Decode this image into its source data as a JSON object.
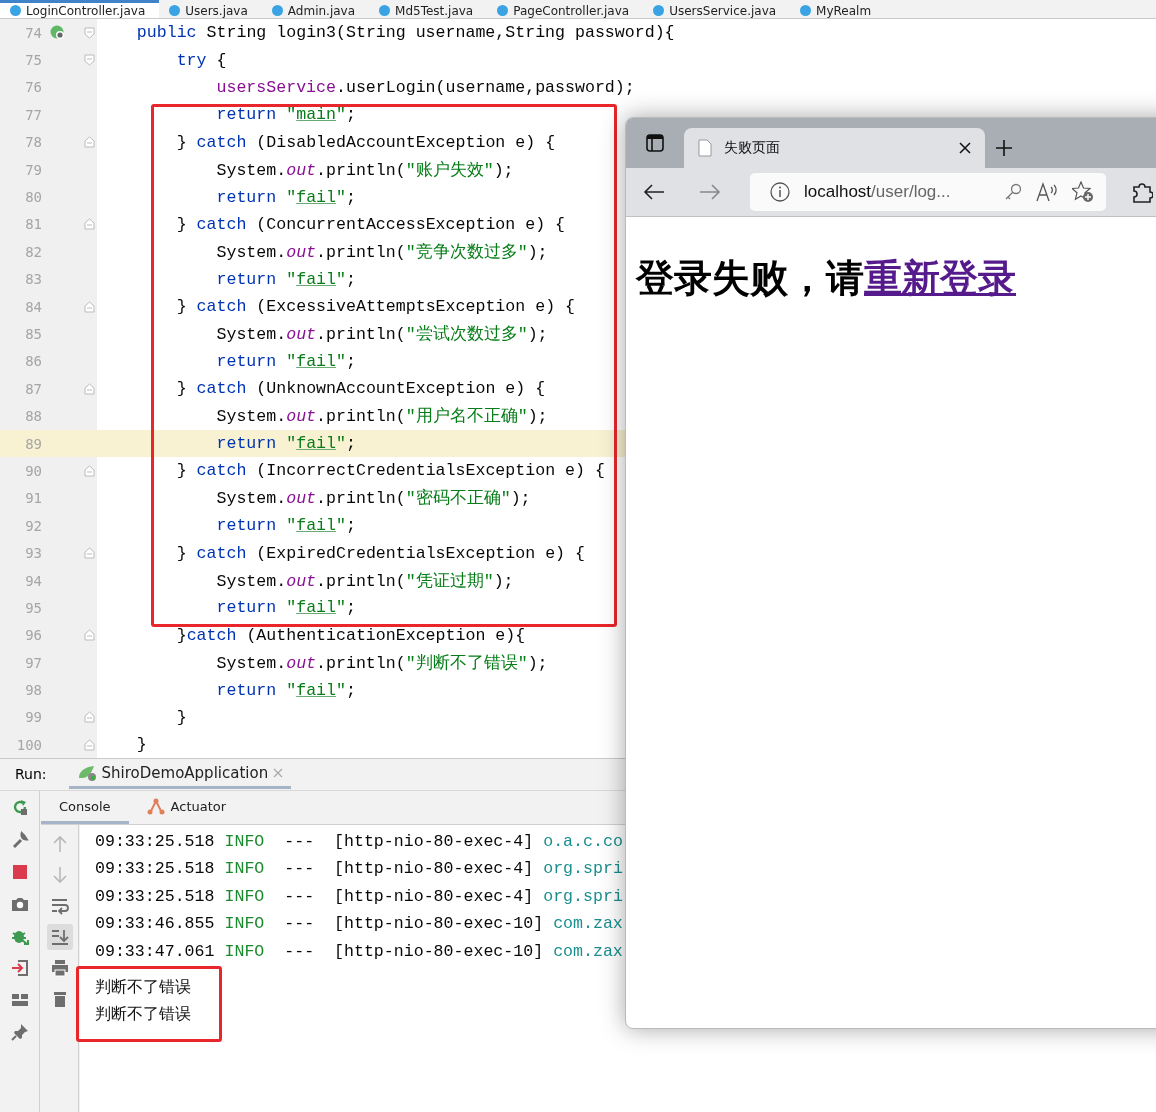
{
  "editor_tabs": [
    {
      "label": "LoginController.java",
      "selected": true
    },
    {
      "label": "Users.java",
      "selected": false
    },
    {
      "label": "Admin.java",
      "selected": false
    },
    {
      "label": "Md5Test.java",
      "selected": false
    },
    {
      "label": "PageController.java",
      "selected": false
    },
    {
      "label": "UsersService.java",
      "selected": false
    },
    {
      "label": "MyRealm",
      "selected": false
    }
  ],
  "code_lines": [
    {
      "number": "74",
      "fold_start": true,
      "fold_end": false,
      "run_marker": true,
      "current": false,
      "tokens": [
        {
          "kind": "keyword",
          "text": "    public"
        },
        {
          "kind": "plain",
          "text": " String login3(String username,String password){"
        }
      ]
    },
    {
      "number": "75",
      "fold_start": true,
      "fold_end": false,
      "run_marker": false,
      "current": false,
      "tokens": [
        {
          "kind": "keyword",
          "text": "        try"
        },
        {
          "kind": "plain",
          "text": " {"
        }
      ]
    },
    {
      "number": "76",
      "fold_start": false,
      "fold_end": false,
      "run_marker": false,
      "current": false,
      "tokens": [
        {
          "kind": "field",
          "text": "            usersService"
        },
        {
          "kind": "plain",
          "text": ".userLogin(username,password);"
        }
      ]
    },
    {
      "number": "77",
      "fold_start": false,
      "fold_end": false,
      "run_marker": false,
      "current": false,
      "tokens": [
        {
          "kind": "keyword",
          "text": "            return"
        },
        {
          "kind": "string",
          "text": " \""
        },
        {
          "kind": "typo",
          "text": "main"
        },
        {
          "kind": "string",
          "text": "\""
        },
        {
          "kind": "plain",
          "text": ";"
        }
      ]
    },
    {
      "number": "78",
      "fold_start": false,
      "fold_end": true,
      "run_marker": false,
      "current": false,
      "tokens": [
        {
          "kind": "plain",
          "text": "        } "
        },
        {
          "kind": "keyword",
          "text": "catch"
        },
        {
          "kind": "plain",
          "text": " (DisabledAccountException e) {"
        }
      ]
    },
    {
      "number": "79",
      "fold_start": false,
      "fold_end": false,
      "run_marker": false,
      "current": false,
      "tokens": [
        {
          "kind": "plain",
          "text": "            System."
        },
        {
          "kind": "static",
          "text": "out"
        },
        {
          "kind": "plain",
          "text": ".println("
        },
        {
          "kind": "string",
          "text": "\"账户失效\""
        },
        {
          "kind": "plain",
          "text": ");"
        }
      ]
    },
    {
      "number": "80",
      "fold_start": false,
      "fold_end": false,
      "run_marker": false,
      "current": false,
      "tokens": [
        {
          "kind": "keyword",
          "text": "            return"
        },
        {
          "kind": "string",
          "text": " \""
        },
        {
          "kind": "typo",
          "text": "fail"
        },
        {
          "kind": "string",
          "text": "\""
        },
        {
          "kind": "plain",
          "text": ";"
        }
      ]
    },
    {
      "number": "81",
      "fold_start": false,
      "fold_end": true,
      "run_marker": false,
      "current": false,
      "tokens": [
        {
          "kind": "plain",
          "text": "        } "
        },
        {
          "kind": "keyword",
          "text": "catch"
        },
        {
          "kind": "plain",
          "text": " (ConcurrentAccessException e) {"
        }
      ]
    },
    {
      "number": "82",
      "fold_start": false,
      "fold_end": false,
      "run_marker": false,
      "current": false,
      "tokens": [
        {
          "kind": "plain",
          "text": "            System."
        },
        {
          "kind": "static",
          "text": "out"
        },
        {
          "kind": "plain",
          "text": ".println("
        },
        {
          "kind": "string",
          "text": "\"竞争次数过多\""
        },
        {
          "kind": "plain",
          "text": ");"
        }
      ]
    },
    {
      "number": "83",
      "fold_start": false,
      "fold_end": false,
      "run_marker": false,
      "current": false,
      "tokens": [
        {
          "kind": "keyword",
          "text": "            return"
        },
        {
          "kind": "string",
          "text": " \""
        },
        {
          "kind": "typo",
          "text": "fail"
        },
        {
          "kind": "string",
          "text": "\""
        },
        {
          "kind": "plain",
          "text": ";"
        }
      ]
    },
    {
      "number": "84",
      "fold_start": false,
      "fold_end": true,
      "run_marker": false,
      "current": false,
      "tokens": [
        {
          "kind": "plain",
          "text": "        } "
        },
        {
          "kind": "keyword",
          "text": "catch"
        },
        {
          "kind": "plain",
          "text": " (ExcessiveAttemptsException e) {"
        }
      ]
    },
    {
      "number": "85",
      "fold_start": false,
      "fold_end": false,
      "run_marker": false,
      "current": false,
      "tokens": [
        {
          "kind": "plain",
          "text": "            System."
        },
        {
          "kind": "static",
          "text": "out"
        },
        {
          "kind": "plain",
          "text": ".println("
        },
        {
          "kind": "string",
          "text": "\"尝试次数过多\""
        },
        {
          "kind": "plain",
          "text": ");"
        }
      ]
    },
    {
      "number": "86",
      "fold_start": false,
      "fold_end": false,
      "run_marker": false,
      "current": false,
      "tokens": [
        {
          "kind": "keyword",
          "text": "            return"
        },
        {
          "kind": "string",
          "text": " \""
        },
        {
          "kind": "typo",
          "text": "fail"
        },
        {
          "kind": "string",
          "text": "\""
        },
        {
          "kind": "plain",
          "text": ";"
        }
      ]
    },
    {
      "number": "87",
      "fold_start": false,
      "fold_end": true,
      "run_marker": false,
      "current": false,
      "tokens": [
        {
          "kind": "plain",
          "text": "        } "
        },
        {
          "kind": "keyword",
          "text": "catch"
        },
        {
          "kind": "plain",
          "text": " (UnknownAccountException e) {"
        }
      ]
    },
    {
      "number": "88",
      "fold_start": false,
      "fold_end": false,
      "run_marker": false,
      "current": false,
      "tokens": [
        {
          "kind": "plain",
          "text": "            System."
        },
        {
          "kind": "static",
          "text": "out"
        },
        {
          "kind": "plain",
          "text": ".println("
        },
        {
          "kind": "string",
          "text": "\"用户名不正确\""
        },
        {
          "kind": "plain",
          "text": ");"
        }
      ]
    },
    {
      "number": "89",
      "fold_start": false,
      "fold_end": false,
      "run_marker": false,
      "current": true,
      "tokens": [
        {
          "kind": "keyword",
          "text": "            return"
        },
        {
          "kind": "string",
          "text": " \""
        },
        {
          "kind": "typo",
          "text": "fail"
        },
        {
          "kind": "string",
          "text": "\""
        },
        {
          "kind": "plain",
          "text": ";"
        }
      ]
    },
    {
      "number": "90",
      "fold_start": false,
      "fold_end": true,
      "run_marker": false,
      "current": false,
      "tokens": [
        {
          "kind": "plain",
          "text": "        } "
        },
        {
          "kind": "keyword",
          "text": "catch"
        },
        {
          "kind": "plain",
          "text": " (IncorrectCredentialsException e) {"
        }
      ]
    },
    {
      "number": "91",
      "fold_start": false,
      "fold_end": false,
      "run_marker": false,
      "current": false,
      "tokens": [
        {
          "kind": "plain",
          "text": "            System."
        },
        {
          "kind": "static",
          "text": "out"
        },
        {
          "kind": "plain",
          "text": ".println("
        },
        {
          "kind": "string",
          "text": "\"密码不正确\""
        },
        {
          "kind": "plain",
          "text": ");"
        }
      ]
    },
    {
      "number": "92",
      "fold_start": false,
      "fold_end": false,
      "run_marker": false,
      "current": false,
      "tokens": [
        {
          "kind": "keyword",
          "text": "            return"
        },
        {
          "kind": "string",
          "text": " \""
        },
        {
          "kind": "typo",
          "text": "fail"
        },
        {
          "kind": "string",
          "text": "\""
        },
        {
          "kind": "plain",
          "text": ";"
        }
      ]
    },
    {
      "number": "93",
      "fold_start": false,
      "fold_end": true,
      "run_marker": false,
      "current": false,
      "tokens": [
        {
          "kind": "plain",
          "text": "        } "
        },
        {
          "kind": "keyword",
          "text": "catch"
        },
        {
          "kind": "plain",
          "text": " (ExpiredCredentialsException e) {"
        }
      ]
    },
    {
      "number": "94",
      "fold_start": false,
      "fold_end": false,
      "run_marker": false,
      "current": false,
      "tokens": [
        {
          "kind": "plain",
          "text": "            System."
        },
        {
          "kind": "static",
          "text": "out"
        },
        {
          "kind": "plain",
          "text": ".println("
        },
        {
          "kind": "string",
          "text": "\"凭证过期\""
        },
        {
          "kind": "plain",
          "text": ");"
        }
      ]
    },
    {
      "number": "95",
      "fold_start": false,
      "fold_end": false,
      "run_marker": false,
      "current": false,
      "tokens": [
        {
          "kind": "keyword",
          "text": "            return"
        },
        {
          "kind": "string",
          "text": " \""
        },
        {
          "kind": "typo",
          "text": "fail"
        },
        {
          "kind": "string",
          "text": "\""
        },
        {
          "kind": "plain",
          "text": ";"
        }
      ]
    },
    {
      "number": "96",
      "fold_start": false,
      "fold_end": true,
      "run_marker": false,
      "current": false,
      "tokens": [
        {
          "kind": "plain",
          "text": "        }"
        },
        {
          "kind": "keyword",
          "text": "catch"
        },
        {
          "kind": "plain",
          "text": " (AuthenticationException e){"
        }
      ]
    },
    {
      "number": "97",
      "fold_start": false,
      "fold_end": false,
      "run_marker": false,
      "current": false,
      "tokens": [
        {
          "kind": "plain",
          "text": "            System."
        },
        {
          "kind": "static",
          "text": "out"
        },
        {
          "kind": "plain",
          "text": ".println("
        },
        {
          "kind": "string",
          "text": "\"判断不了错误\""
        },
        {
          "kind": "plain",
          "text": ");"
        }
      ]
    },
    {
      "number": "98",
      "fold_start": false,
      "fold_end": false,
      "run_marker": false,
      "current": false,
      "tokens": [
        {
          "kind": "keyword",
          "text": "            return"
        },
        {
          "kind": "string",
          "text": " \""
        },
        {
          "kind": "typo",
          "text": "fail"
        },
        {
          "kind": "string",
          "text": "\""
        },
        {
          "kind": "plain",
          "text": ";"
        }
      ]
    },
    {
      "number": "99",
      "fold_start": false,
      "fold_end": true,
      "run_marker": false,
      "current": false,
      "tokens": [
        {
          "kind": "plain",
          "text": "        }"
        }
      ]
    },
    {
      "number": "100",
      "fold_start": false,
      "fold_end": true,
      "run_marker": false,
      "current": false,
      "tokens": [
        {
          "kind": "plain",
          "text": "    }"
        }
      ]
    }
  ],
  "run_panel": {
    "label": "Run:",
    "config_tab": {
      "label": "ShiroDemoApplication",
      "selected": true
    },
    "sub_tabs": [
      {
        "label": "Console",
        "selected": true
      },
      {
        "label": "Actuator",
        "selected": false
      }
    ],
    "log_lines": [
      {
        "time": "09:33:25.518",
        "level": "INFO",
        "separator": "---",
        "thread": "[http-nio-80-exec-4]",
        "logger": "o.a.c.co"
      },
      {
        "time": "09:33:25.518",
        "level": "INFO",
        "separator": "---",
        "thread": "[http-nio-80-exec-4]",
        "logger": "org.spri"
      },
      {
        "time": "09:33:25.518",
        "level": "INFO",
        "separator": "---",
        "thread": "[http-nio-80-exec-4]",
        "logger": "org.spri"
      },
      {
        "time": "09:33:46.855",
        "level": "INFO",
        "separator": "---",
        "thread": "[http-nio-80-exec-10]",
        "logger": "com.zax"
      },
      {
        "time": "09:33:47.061",
        "level": "INFO",
        "separator": "---",
        "thread": "[http-nio-80-exec-10]",
        "logger": "com.zax"
      }
    ],
    "output_lines": [
      "判断不了错误",
      "判断不了错误"
    ]
  },
  "browser": {
    "tab": {
      "title": "失败页面"
    },
    "address": {
      "host": "localhost",
      "path": "/user/log..."
    },
    "heading": {
      "text": "登录失败，请",
      "link": "重新登录"
    }
  }
}
